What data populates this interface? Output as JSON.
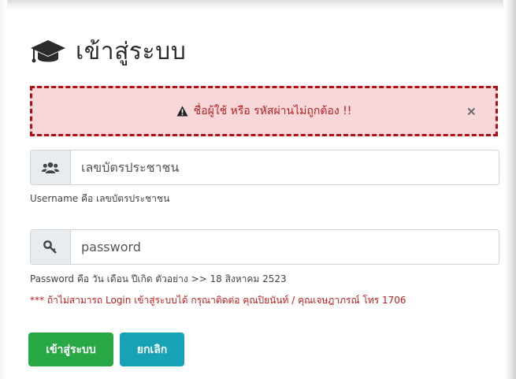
{
  "header": {
    "title": "เข้าสู่ระบบ",
    "icon": "graduation-cap-icon"
  },
  "alert": {
    "message": "ชื่อผู้ใช้ หรือ รหัสผ่านไม่ถูกต้อง !!",
    "close": "×",
    "icon": "warning-triangle-icon",
    "border_color": "#b00e14",
    "background": "#f8d7da"
  },
  "username": {
    "icon": "users-icon",
    "placeholder": "เลขบัตรประชาชน",
    "value": "",
    "help": "Username คือ เลขบัตรประชาชน"
  },
  "password": {
    "icon": "key-icon",
    "placeholder": "password",
    "value": "",
    "help": "Password คือ วัน เดือน ปีเกิด ตัวอย่าง >> 18 สิงหาคม 2523",
    "warning": "*** ถ้าไม่สามารถ Login เข้าสู่ระบบได้ กรุณาติดต่อ คุณปิยนันท์ / คุณเจษฎาภรณ์ โทร 1706"
  },
  "buttons": {
    "login_label": "เข้าสู่ระบบ",
    "cancel_label": "ยกเลิก",
    "login_color": "#28a745",
    "cancel_color": "#17a2b8"
  }
}
